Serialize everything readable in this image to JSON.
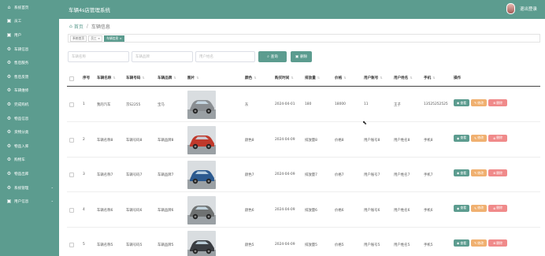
{
  "header": {
    "title": "车辆4s店管理系统",
    "logout": "退出登录"
  },
  "sidebar": {
    "items": [
      {
        "label": "系统首页",
        "icon": "home-icon",
        "glyph": "⌂"
      },
      {
        "label": "员工",
        "icon": "user-icon",
        "glyph": "▣"
      },
      {
        "label": "用户",
        "icon": "user-icon",
        "glyph": "▣"
      },
      {
        "label": "车辆信息",
        "icon": "car-icon",
        "glyph": "⚙"
      },
      {
        "label": "售后服务",
        "icon": "gear-icon",
        "glyph": "⚙"
      },
      {
        "label": "售后反馈",
        "icon": "gear-icon",
        "glyph": "⚙"
      },
      {
        "label": "车辆维修",
        "icon": "gear-icon",
        "glyph": "⚙"
      },
      {
        "label": "完成购机",
        "icon": "gear-icon",
        "glyph": "⚙"
      },
      {
        "label": "物品信息",
        "icon": "gear-icon",
        "glyph": "⚙"
      },
      {
        "label": "货物分类",
        "icon": "gear-icon",
        "glyph": "⚙"
      },
      {
        "label": "物品入库",
        "icon": "gear-icon",
        "glyph": "⚙"
      },
      {
        "label": "购物车",
        "icon": "gear-icon",
        "glyph": "⚙"
      },
      {
        "label": "物品出库",
        "icon": "gear-icon",
        "glyph": "⚙"
      },
      {
        "label": "系统管理",
        "icon": "gear-icon",
        "glyph": "⚙",
        "caret": "⌄"
      },
      {
        "label": "用户信息",
        "icon": "user-icon",
        "glyph": "▣",
        "caret": "⌄"
      }
    ]
  },
  "breadcrumb": {
    "home": "首页",
    "sep": "/",
    "current": "车辆信息"
  },
  "tags": [
    {
      "label": "系统首页",
      "active": false
    },
    {
      "label": "员工 ×",
      "active": false
    },
    {
      "label": "车辆信息 ×",
      "active": true
    }
  ],
  "search": {
    "name_placeholder": "车辆名称",
    "brand_placeholder": "车辆品牌",
    "user_placeholder": "用户姓名",
    "search_label": "查询",
    "delete_label": "删除"
  },
  "table": {
    "headers": [
      "序号",
      "车辆名称",
      "车辆号码",
      "车辆品牌",
      "图片",
      "颜色",
      "购买时间",
      "排放量",
      "价格",
      "用户账号",
      "用户姓名",
      "手机",
      "操作"
    ],
    "rows": [
      {
        "no": "1",
        "name": "我的汽车",
        "plate": "京S2255",
        "brand": "宝马",
        "color": "灰",
        "date": "2024-04-01",
        "emission": "180",
        "price": "18000",
        "account": "11",
        "username": "王子",
        "phone": "13525252525",
        "car_color": "#8a8e92"
      },
      {
        "no": "2",
        "name": "车辆名称8",
        "plate": "车辆号码8",
        "brand": "车辆品牌8",
        "color": "颜色8",
        "date": "2024-04-09",
        "emission": "排放量8",
        "price": "价格8",
        "account": "用户账号8",
        "username": "用户姓名8",
        "phone": "手机8",
        "car_color": "#c0392b"
      },
      {
        "no": "3",
        "name": "车辆名称7",
        "plate": "车辆号码7",
        "brand": "车辆品牌7",
        "color": "颜色7",
        "date": "2024-04-09",
        "emission": "排放量7",
        "price": "价格7",
        "account": "用户账号7",
        "username": "用户姓名7",
        "phone": "手机7",
        "car_color": "#2c5a8f"
      },
      {
        "no": "4",
        "name": "车辆名称6",
        "plate": "车辆号码6",
        "brand": "车辆品牌6",
        "color": "颜色6",
        "date": "2024-04-09",
        "emission": "排放量6",
        "price": "价格6",
        "account": "用户账号6",
        "username": "用户姓名6",
        "phone": "手机6",
        "car_color": "#6f7272"
      },
      {
        "no": "5",
        "name": "车辆名称5",
        "plate": "车辆号码5",
        "brand": "车辆品牌5",
        "color": "颜色5",
        "date": "2024-04-09",
        "emission": "排放量5",
        "price": "价格5",
        "account": "用户账号5",
        "username": "用户姓名5",
        "phone": "手机5",
        "car_color": "#3a3d42"
      }
    ],
    "actions": {
      "view": "查看",
      "edit": "修改",
      "delete": "删除"
    }
  },
  "colors": {
    "primary": "#5c9c8f",
    "edit": "#f0b070",
    "danger": "#f08a8a"
  }
}
